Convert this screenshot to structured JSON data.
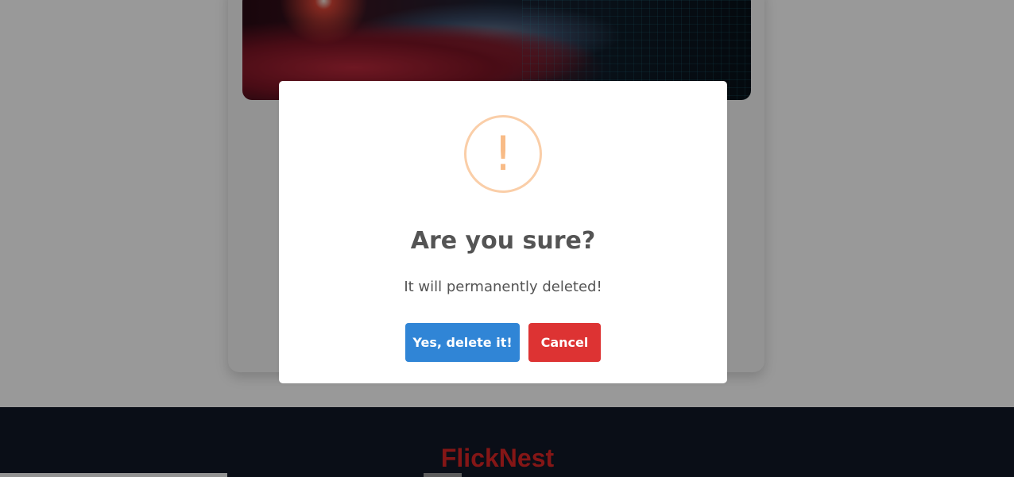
{
  "background": {
    "footer": {
      "brand": "FlickNest"
    }
  },
  "dialog": {
    "icon": "warning-exclamation-icon",
    "icon_glyph": "!",
    "title": "Are you sure?",
    "text": "It will permanently deleted!",
    "confirm_label": "Yes, delete it!",
    "cancel_label": "Cancel"
  },
  "colors": {
    "confirm": "#3085d6",
    "cancel": "#dd3333",
    "warning": "#f8bb86",
    "brand": "#dc2626",
    "footer_bg": "#111827"
  }
}
